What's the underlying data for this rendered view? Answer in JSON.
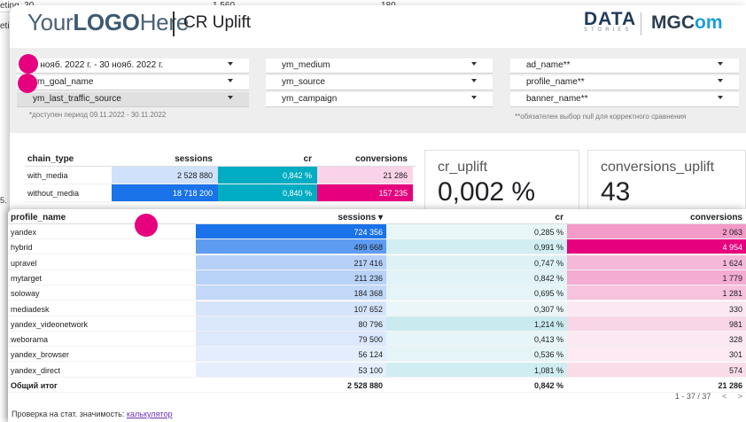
{
  "background": {
    "frag_label": "eting_30",
    "frag_value1": "1 560",
    "frag_value2": "180",
    "side_label": "eti",
    "side_label2": "5."
  },
  "header": {
    "logo_prefix": "Your",
    "logo_bold": "LOGO",
    "logo_suffix": "Here",
    "title": "CR Uplift",
    "brand1": "DATA",
    "brand1_sub": "STORIES",
    "brand2_prefix": "MGC",
    "brand2_suffix": "om"
  },
  "filters": {
    "col1": [
      {
        "label": "9 нояб. 2022 г. - 30 нояб. 2022 г."
      },
      {
        "label": "ym_goal_name"
      },
      {
        "label": "ym_last_traffic_source"
      }
    ],
    "col2": [
      {
        "label": "ym_medium"
      },
      {
        "label": "ym_source"
      },
      {
        "label": "ym_campaign"
      }
    ],
    "col3": [
      {
        "label": "ad_name**"
      },
      {
        "label": "profile_name**"
      },
      {
        "label": "banner_name**"
      }
    ],
    "note_left": "*доступен период 09.11.2022 - 30.11.2022",
    "note_right": "**обязателен выбор null для корректного сравнения"
  },
  "chain_table": {
    "headers": [
      "chain_type",
      "sessions",
      "cr",
      "conversions"
    ],
    "rows": [
      [
        "with_media",
        "2 528 880",
        "0,842 %",
        "21 286"
      ],
      [
        "without_media",
        "18 718 200",
        "0,840 %",
        "157 235"
      ]
    ]
  },
  "scorecards": {
    "cr_uplift_label": "cr_uplift",
    "cr_uplift_value": "0,002 %",
    "conversions_uplift_label": "conversions_uplift",
    "conversions_uplift_value": "43"
  },
  "profile_table": {
    "headers": [
      "profile_name",
      "sessions ▾",
      "cr",
      "conversions"
    ],
    "rows": [
      [
        "yandex",
        "724 356",
        "0,285 %",
        "2 063"
      ],
      [
        "hybrid",
        "499 668",
        "0,991 %",
        "4 954"
      ],
      [
        "upravel",
        "217 416",
        "0,747 %",
        "1 624"
      ],
      [
        "mytarget",
        "211 236",
        "0,842 %",
        "1 779"
      ],
      [
        "soloway",
        "184 368",
        "0,695 %",
        "1 281"
      ],
      [
        "mediadesk",
        "107 652",
        "0,307 %",
        "330"
      ],
      [
        "yandex_videonetwork",
        "80 796",
        "1,214 %",
        "981"
      ],
      [
        "weborama",
        "79 500",
        "0,413 %",
        "328"
      ],
      [
        "yandex_browser",
        "56 124",
        "0,536 %",
        "301"
      ],
      [
        "yandex_direct",
        "53 100",
        "1,081 %",
        "574"
      ]
    ],
    "total": [
      "Общий итог",
      "2 528 880",
      "0,842 %",
      "21 286"
    ],
    "pagination": "1 - 37 / 37",
    "prev": "<",
    "next": ">"
  },
  "footer": {
    "text": "Проверка на стат. значимость: ",
    "link": "калькулятор"
  },
  "colors": {
    "accent_pink": "#e6007e",
    "sessions_heat": "#1a73e8",
    "cr_heat": "#00acc1",
    "conv_heat": "#e6007e"
  }
}
